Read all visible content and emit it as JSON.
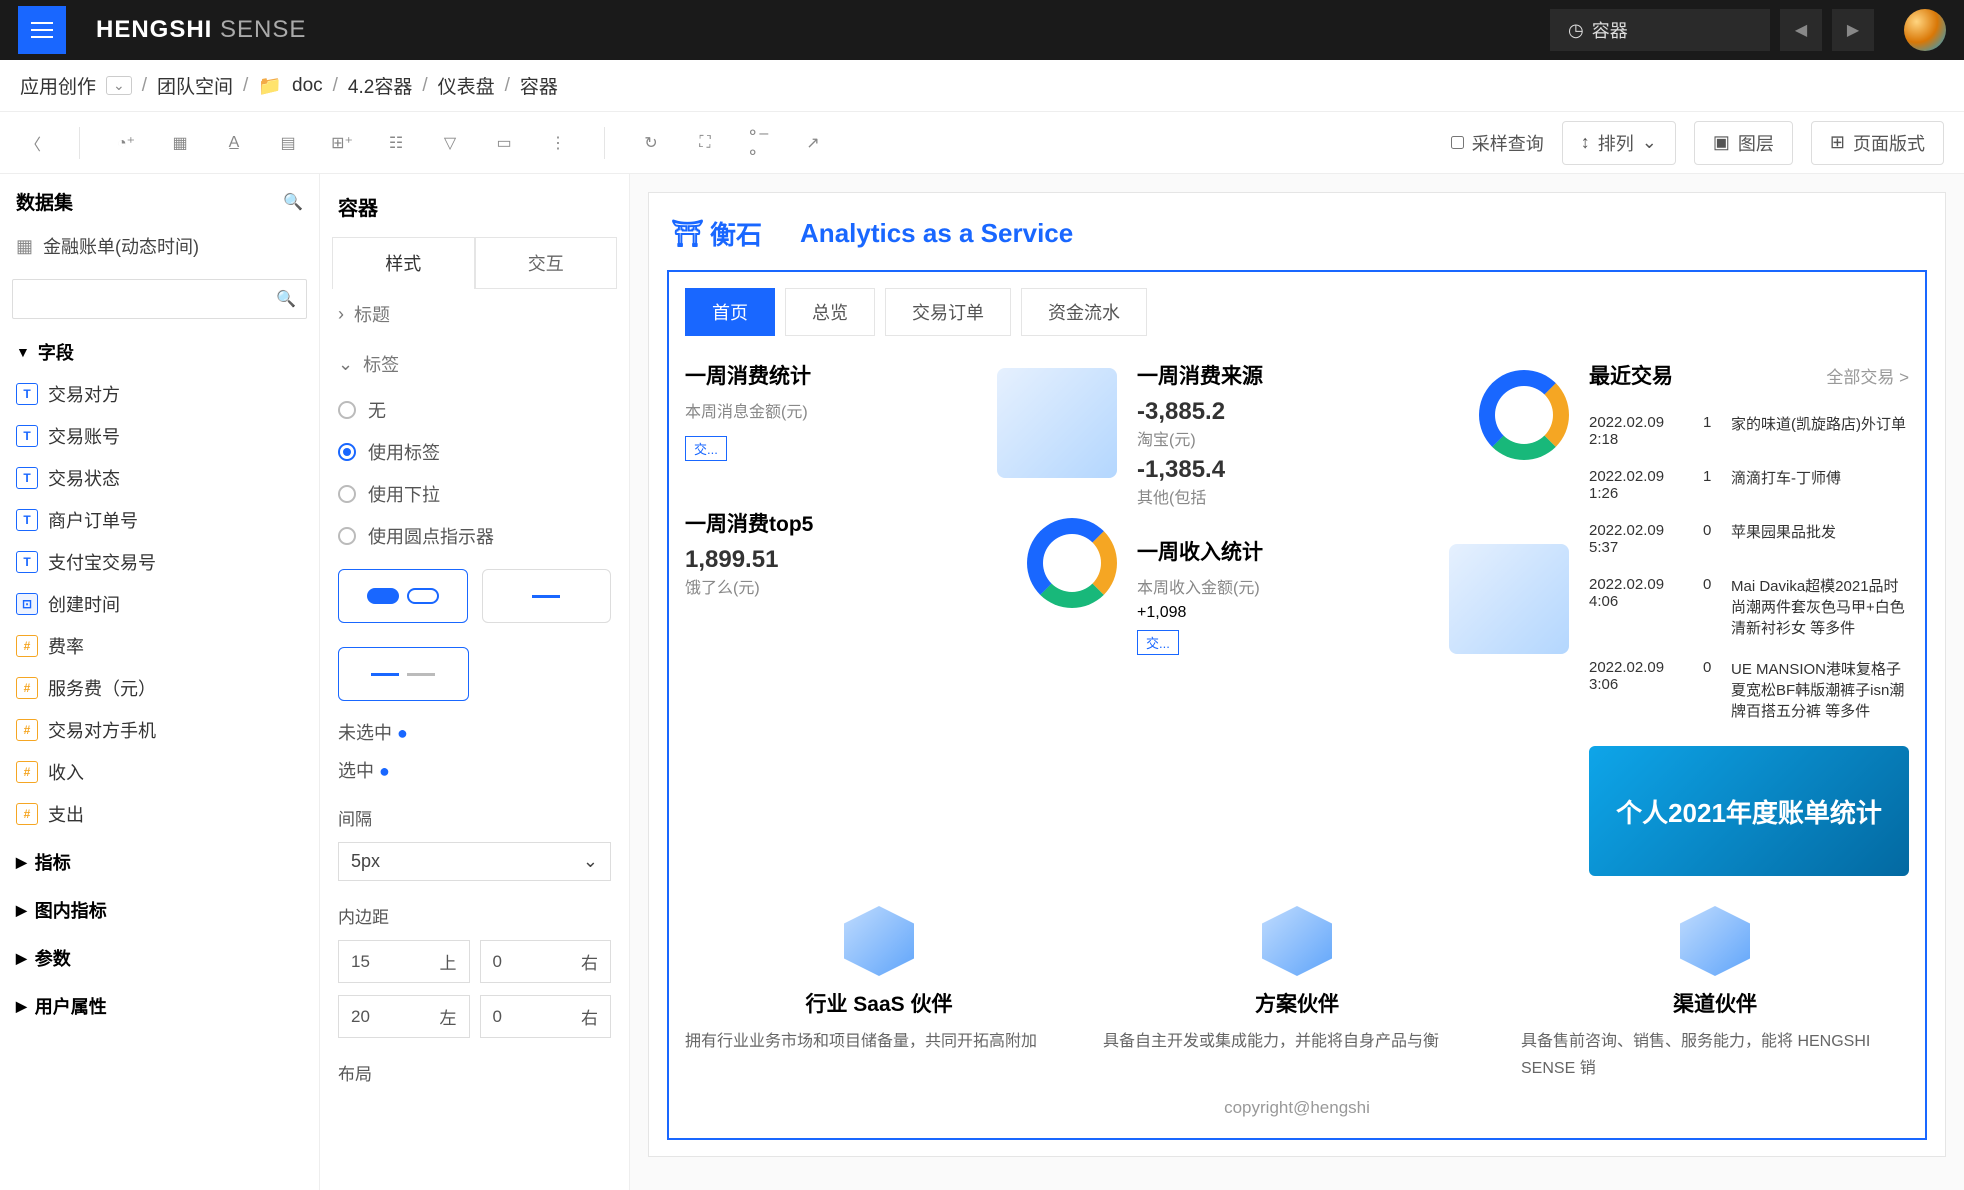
{
  "brand": {
    "bold": "HENGSHI",
    "light": "SENSE"
  },
  "top": {
    "indicator": "容器"
  },
  "breadcrumb": {
    "root": "应用创作",
    "team": "团队空间",
    "folder": "doc",
    "container": "4.2容器",
    "dash": "仪表盘",
    "current": "容器"
  },
  "toolbar": {
    "sample": "采样查询",
    "sort": "排列",
    "layer": "图层",
    "layout": "页面版式"
  },
  "left": {
    "datasets_title": "数据集",
    "dataset_name": "金融账单(动态时间)",
    "sections": {
      "fields": "字段",
      "metrics": "指标",
      "inchart": "图内指标",
      "params": "参数",
      "userattr": "用户属性"
    },
    "fields": [
      {
        "type": "T",
        "label": "交易对方"
      },
      {
        "type": "T",
        "label": "交易账号"
      },
      {
        "type": "T",
        "label": "交易状态"
      },
      {
        "type": "T",
        "label": "商户订单号"
      },
      {
        "type": "T",
        "label": "支付宝交易号"
      },
      {
        "type": "D",
        "label": "创建时间"
      },
      {
        "type": "H",
        "label": "费率"
      },
      {
        "type": "H",
        "label": "服务费（元）"
      },
      {
        "type": "H",
        "label": "交易对方手机"
      },
      {
        "type": "H",
        "label": "收入"
      },
      {
        "type": "H",
        "label": "支出"
      }
    ]
  },
  "mid": {
    "title": "容器",
    "tabs": {
      "style": "样式",
      "inter": "交互"
    },
    "section_title": "标题",
    "section_label": "标签",
    "radios": {
      "none": "无",
      "use_label": "使用标签",
      "use_dd": "使用下拉",
      "use_dot": "使用圆点指示器"
    },
    "unselected": "未选中",
    "selected": "选中",
    "gap_label": "间隔",
    "gap_value": "5px",
    "padding_label": "内边距",
    "pad": {
      "top": "15",
      "top_l": "上",
      "right": "0",
      "right_l": "右",
      "bottom": "20",
      "bottom_l": "左",
      "last": "0",
      "last_l": "右"
    },
    "layout_label": "布局"
  },
  "dash": {
    "logo_text": "衡石",
    "slogan": "Analytics as a Service",
    "tabs": [
      "首页",
      "总览",
      "交易订单",
      "资金流水"
    ],
    "week_stats": {
      "title": "一周消费统计",
      "sub": "本周消息金额(元)",
      "tag": "交..."
    },
    "week_src": {
      "title": "一周消费来源",
      "v1": "-3,885.2",
      "l1": "淘宝(元)",
      "v2": "-1,385.4",
      "l2": "其他(包括"
    },
    "top5": {
      "title": "一周消费top5",
      "value": "1,899.51",
      "sub": "饿了么(元)"
    },
    "income": {
      "title": "一周收入统计",
      "sub": "本周收入金额(元)",
      "value": "+1,098",
      "tag": "交..."
    },
    "recent": {
      "title": "最近交易",
      "all": "全部交易 >",
      "items": [
        {
          "date": "2022.02.09 2:18",
          "n": "1",
          "desc": "家的味道(凯旋路店)外订单"
        },
        {
          "date": "2022.02.09 1:26",
          "n": "1",
          "desc": "滴滴打车-丁师傅"
        },
        {
          "date": "2022.02.09 5:37",
          "n": "0",
          "desc": "苹果园果品批发"
        },
        {
          "date": "2022.02.09 4:06",
          "n": "0",
          "desc": "Mai Davika超模2021品时尚潮两件套灰色马甲+白色清新衬衫女 等多件"
        },
        {
          "date": "2022.02.09 3:06",
          "n": "0",
          "desc": "UE MANSION港味复格子夏宽松BF韩版潮裤子isn潮牌百搭五分裤 等多件"
        }
      ]
    },
    "promo": "个人2021年度账单统计",
    "partners": [
      {
        "title": "行业 SaaS 伙伴",
        "desc": "拥有行业业务市场和项目储备量，共同开拓高附加"
      },
      {
        "title": "方案伙伴",
        "desc": "具备自主开发或集成能力，并能将自身产品与衡"
      },
      {
        "title": "渠道伙伴",
        "desc": "具备售前咨询、销售、服务能力，能将 HENGSHI SENSE 销"
      }
    ],
    "footer": "copyright@hengshi"
  }
}
